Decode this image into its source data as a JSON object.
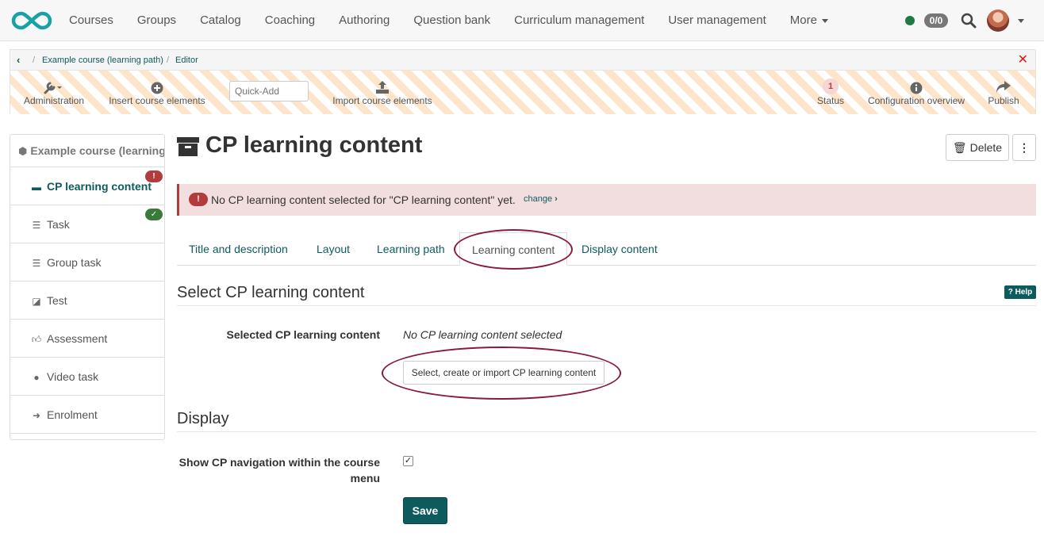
{
  "colors": {
    "accent": "#0e5b5e",
    "error": "#b23b3b",
    "success": "#3a7a3a",
    "annotation": "#8b1a3a"
  },
  "topnav": {
    "items": [
      {
        "label": "Courses"
      },
      {
        "label": "Groups"
      },
      {
        "label": "Catalog"
      },
      {
        "label": "Coaching"
      },
      {
        "label": "Authoring"
      },
      {
        "label": "Question bank"
      },
      {
        "label": "Curriculum management"
      },
      {
        "label": "User management"
      },
      {
        "label": "More"
      }
    ],
    "counter": "0/0"
  },
  "breadcrumb": {
    "course": "Example course (learning path)",
    "editor": "Editor"
  },
  "toolbar": {
    "administration": "Administration",
    "insert": "Insert course elements",
    "quickadd_placeholder": "Quick-Add",
    "import": "Import course elements",
    "status": "Status",
    "status_count": "1",
    "config": "Configuration overview",
    "publish": "Publish"
  },
  "sidebar": {
    "course": "Example course (learning path)",
    "items": [
      {
        "label": "CP learning content",
        "icon": "archive-icon"
      },
      {
        "label": "Task",
        "icon": "task-icon"
      },
      {
        "label": "Group task",
        "icon": "task-icon"
      },
      {
        "label": "Test",
        "icon": "edit-icon"
      },
      {
        "label": "Assessment",
        "icon": "thumbs-up-icon"
      },
      {
        "label": "Video task",
        "icon": "record-icon"
      },
      {
        "label": "Enrolment",
        "icon": "sign-in-icon"
      }
    ]
  },
  "main": {
    "title": "CP learning content",
    "delete_label": "Delete",
    "more_label": "⋮",
    "alert": {
      "text": "No CP learning content selected for \"CP learning content\" yet.",
      "link": "change"
    },
    "tabs": [
      {
        "label": "Title and description"
      },
      {
        "label": "Layout"
      },
      {
        "label": "Learning path"
      },
      {
        "label": "Learning content"
      },
      {
        "label": "Display content"
      }
    ],
    "select_section": "Select CP learning content",
    "help": "Help",
    "selected_label": "Selected CP learning content",
    "selected_value": "No CP learning content selected",
    "select_button": "Select, create or import CP learning content",
    "display_section": "Display",
    "nav_label": "Show CP navigation within the course menu",
    "nav_checked": true,
    "save": "Save"
  }
}
